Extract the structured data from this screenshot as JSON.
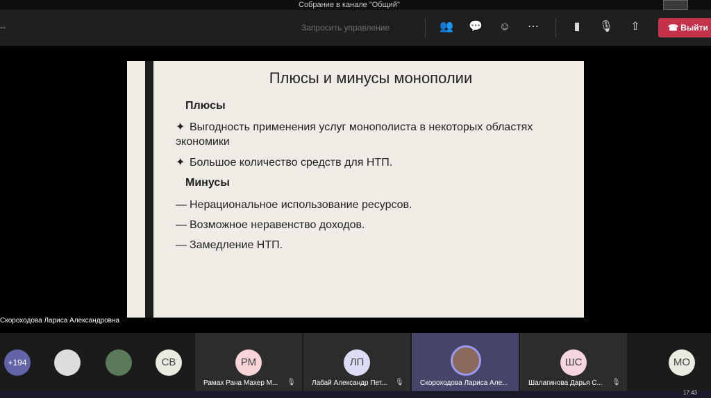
{
  "window": {
    "title": "Собрание в канале \"Общий\""
  },
  "toolbar": {
    "timer": "--",
    "request_control": "Запросить управление",
    "leave": "Выйти"
  },
  "slide": {
    "title": "Плюсы и минусы монополии",
    "pros_heading": "Плюсы",
    "pros": [
      "Выгодность применения услуг монополиста в некоторых областях экономики",
      "Большое количество средств для НТП."
    ],
    "cons_heading": "Минусы",
    "cons": [
      "Нерациональное использование ресурсов.",
      "Возможное неравенство доходов.",
      "Замедление НТП."
    ]
  },
  "presenter_name": "Скороходова Лариса Александровна",
  "participants": {
    "overflow": "+194",
    "avatars": [
      {
        "initials": "СВ",
        "color": "#e8ece0"
      },
      {
        "initials": "РМ",
        "name": "Рамах Рана Махер М...",
        "color": "#f6d4d8"
      },
      {
        "initials": "ЛП",
        "name": "Лабай Александр Пет...",
        "color": "#dcdcf4"
      },
      {
        "initials": "",
        "name": "Скороходова Лариса Але...",
        "color": "#8a6a5a"
      },
      {
        "initials": "ШС",
        "name": "Шалагинова Дарья С...",
        "color": "#f6d4e0"
      },
      {
        "initials": "МО",
        "color": "#e8ece0"
      }
    ]
  },
  "taskbar": {
    "time": "17:43"
  }
}
